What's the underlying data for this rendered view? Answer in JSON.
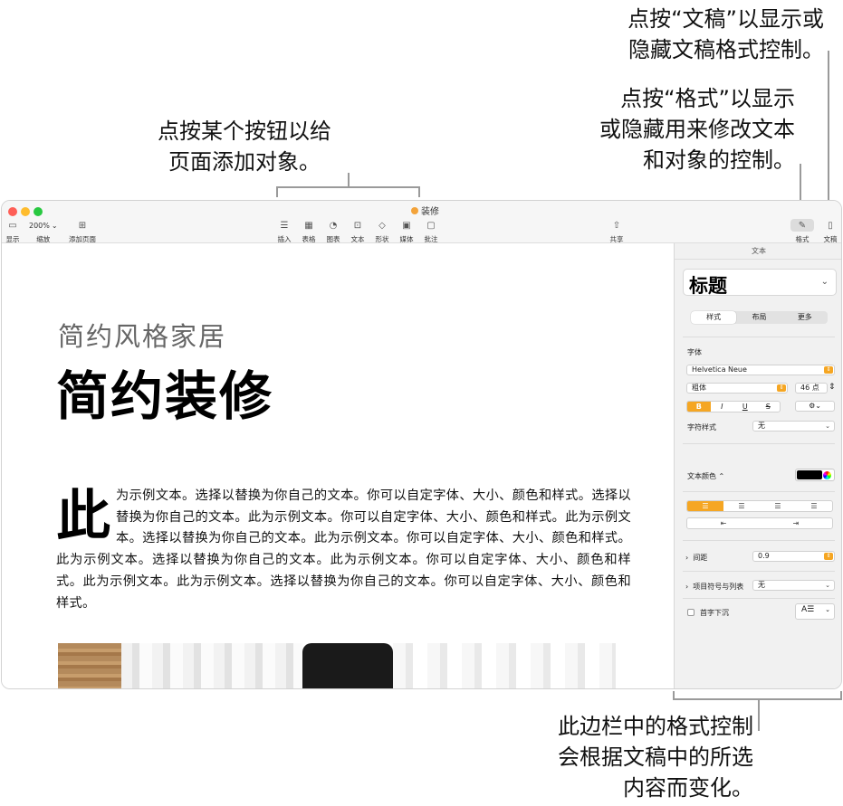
{
  "callouts": {
    "document": [
      "点按“文稿”以显示或",
      "隐藏文稿格式控制。"
    ],
    "format": [
      "点按“格式”以显示",
      "或隐藏用来修改文本",
      "和对象的控制。"
    ],
    "add_objects": [
      "点按某个按钮以给",
      "页面添加对象。"
    ],
    "sidebar": [
      "此边栏中的格式控制",
      "会根据文稿中的所选",
      "内容而变化。"
    ]
  },
  "window": {
    "title": "装修",
    "toolbar": {
      "view": "显示",
      "zoom": "缩放",
      "zoom_value": "200%",
      "add_page": "添加页面",
      "insert": "插入",
      "table": "表格",
      "chart": "图表",
      "text": "文本",
      "shape": "形状",
      "media": "媒体",
      "comment": "批注",
      "share": "共享",
      "format": "格式",
      "document": "文稿"
    }
  },
  "document": {
    "subtitle": "简约风格家居",
    "title": "简约装修",
    "dropcap": "此",
    "body": "为示例文本。选择以替换为你自己的文本。你可以自定字体、大小、颜色和样式。选择以替换为你自己的文本。此为示例文本。你可以自定字体、大小、颜色和样式。此为示例文本。选择以替换为你自己的文本。此为示例文本。你可以自定字体、大小、颜色和样式。此为示例文本。选择以替换为你自己的文本。此为示例文本。你可以自定字体、大小、颜色和样式。此为示例文本。此为示例文本。选择以替换为你自己的文本。你可以自定字体、大小、颜色和样式。"
  },
  "sidebar": {
    "header": "文本",
    "paragraph_style": "标题",
    "tabs": [
      "样式",
      "布局",
      "更多"
    ],
    "active_tab": "样式",
    "font_label": "字体",
    "font_name": "Helvetica Neue",
    "font_weight": "粗体",
    "font_size": "46 点",
    "bius": [
      "B",
      "I",
      "U",
      "S"
    ],
    "char_style_label": "字符样式",
    "char_style_value": "无",
    "text_color_label": "文本颜色 ⌃",
    "spacing_label": "间距",
    "spacing_value": "0.9",
    "bullets_label": "项目符号与列表",
    "bullets_value": "无",
    "dropcap_label": "首字下沉",
    "colors": {
      "accent": "#f5a623",
      "text_color": "#000000"
    }
  }
}
